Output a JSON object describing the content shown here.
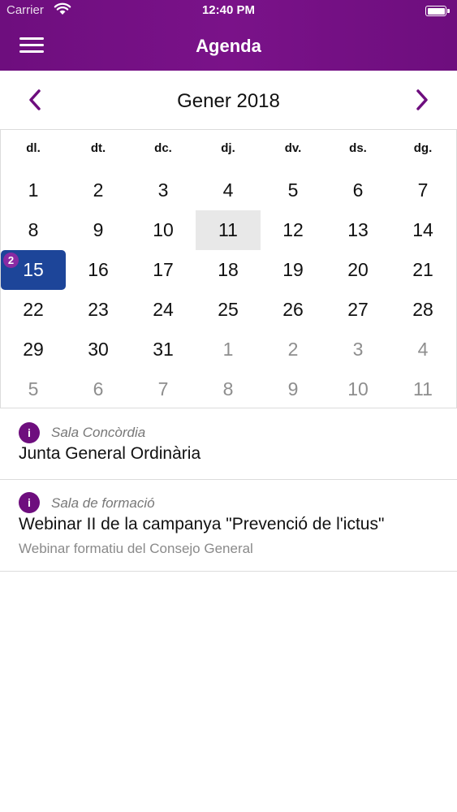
{
  "status_bar": {
    "carrier": "Carrier",
    "time": "12:40 PM"
  },
  "nav": {
    "title": "Agenda",
    "menu_icon": "hamburger-menu-icon"
  },
  "calendar": {
    "month_title": "Gener 2018",
    "prev_icon": "chevron-left-icon",
    "next_icon": "chevron-right-icon",
    "accent_color": "#6e0e7e",
    "selected_color": "#1d4599",
    "weekdays": [
      "dl.",
      "dt.",
      "dc.",
      "dj.",
      "dv.",
      "ds.",
      "dg."
    ],
    "weeks": [
      [
        {
          "d": "1"
        },
        {
          "d": "2"
        },
        {
          "d": "3"
        },
        {
          "d": "4"
        },
        {
          "d": "5"
        },
        {
          "d": "6"
        },
        {
          "d": "7"
        }
      ],
      [
        {
          "d": "8"
        },
        {
          "d": "9"
        },
        {
          "d": "10"
        },
        {
          "d": "11",
          "today": true
        },
        {
          "d": "12"
        },
        {
          "d": "13"
        },
        {
          "d": "14"
        }
      ],
      [
        {
          "d": "15",
          "selected": true,
          "badge": "2"
        },
        {
          "d": "16"
        },
        {
          "d": "17"
        },
        {
          "d": "18"
        },
        {
          "d": "19"
        },
        {
          "d": "20"
        },
        {
          "d": "21"
        }
      ],
      [
        {
          "d": "22"
        },
        {
          "d": "23"
        },
        {
          "d": "24"
        },
        {
          "d": "25"
        },
        {
          "d": "26"
        },
        {
          "d": "27"
        },
        {
          "d": "28"
        }
      ],
      [
        {
          "d": "29"
        },
        {
          "d": "30"
        },
        {
          "d": "31"
        },
        {
          "d": "1",
          "other": true
        },
        {
          "d": "2",
          "other": true
        },
        {
          "d": "3",
          "other": true
        },
        {
          "d": "4",
          "other": true
        }
      ],
      [
        {
          "d": "5",
          "other": true
        },
        {
          "d": "6",
          "other": true
        },
        {
          "d": "7",
          "other": true
        },
        {
          "d": "8",
          "other": true
        },
        {
          "d": "9",
          "other": true
        },
        {
          "d": "10",
          "other": true
        },
        {
          "d": "11",
          "other": true
        }
      ]
    ]
  },
  "events": [
    {
      "icon": "i",
      "location": "Sala Concòrdia",
      "title": "Junta General Ordinària",
      "description": ""
    },
    {
      "icon": "i",
      "location": "Sala de formació",
      "title": "Webinar II de la campanya \"Prevenció de l'ictus\"",
      "description": "Webinar formatiu del Consejo General"
    }
  ]
}
